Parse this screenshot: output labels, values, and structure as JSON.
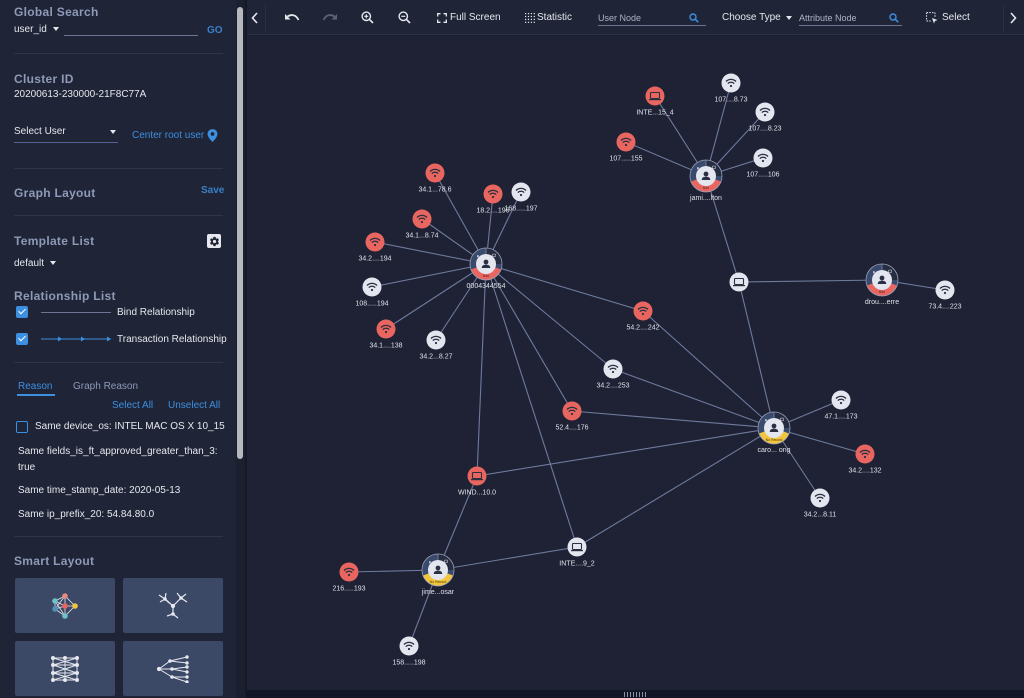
{
  "sidebar": {
    "global_search": {
      "title": "Global Search",
      "field_select": "user_id",
      "input_value": "",
      "go_label": "GO"
    },
    "cluster": {
      "title": "Cluster ID",
      "value": "20200613-230000-21F8C77A",
      "select_user_label": "Select User",
      "center_root_label": "Center root user"
    },
    "graph_layout": {
      "title": "Graph Layout",
      "save_label": "Save"
    },
    "template_list": {
      "title": "Template List",
      "selected": "default"
    },
    "relationship_list": {
      "title": "Relationship List",
      "items": [
        {
          "label": "Bind Relationship",
          "checked": true,
          "style": "solid"
        },
        {
          "label": "Transaction Relationship",
          "checked": true,
          "style": "arrows"
        }
      ]
    },
    "reason": {
      "tabs": [
        {
          "label": "Reason",
          "active": true
        },
        {
          "label": "Graph Reason",
          "active": false
        }
      ],
      "select_all_label": "Select All",
      "unselect_all_label": "Unselect All",
      "items": [
        {
          "text": "Same device_os: INTEL MAC OS X 10_15",
          "checkbox": true,
          "checked": false
        },
        {
          "text": "Same fields_is_ft_approved_greater_than_3:",
          "text2": "true",
          "checkbox": false
        },
        {
          "text": "Same time_stamp_date: 2020-05-13",
          "checkbox": false
        },
        {
          "text": "Same ip_prefix_20: 54.84.80.0",
          "checkbox": false
        }
      ]
    },
    "smart_layout": {
      "title": "Smart Layout",
      "buttons": [
        {
          "name": "force-layout",
          "icon": "force-graph-icon"
        },
        {
          "name": "radial-tree-layout",
          "icon": "radial-tree-icon"
        },
        {
          "name": "grid-layout",
          "icon": "grid-mesh-icon"
        },
        {
          "name": "dagre-layout",
          "icon": "hierarchy-tree-icon"
        }
      ]
    }
  },
  "toolbar": {
    "undo_icon": "undo-icon",
    "redo_icon": "redo-icon",
    "zoom_in_icon": "zoom-in-icon",
    "zoom_out_icon": "zoom-out-icon",
    "fullscreen_label": "Full Screen",
    "statistic_label": "Statistic",
    "user_node_placeholder": "User Node",
    "choose_type_label": "Choose Type",
    "attribute_node_placeholder": "Attribute Node",
    "select_label": "Select"
  },
  "colors": {
    "accent": "#3d8fe0",
    "bad": "#e8665f",
    "no_record": "#f2c53d",
    "neutral_node": "#e3e6ef",
    "edge": "#7d8bb0"
  },
  "graph": {
    "nodes": [
      {
        "id": "u1",
        "type": "user",
        "label": "0004344554",
        "status": "Bad"
      },
      {
        "id": "u2",
        "type": "user",
        "label": "jami....lton",
        "status": "Bad"
      },
      {
        "id": "u3",
        "type": "user",
        "label": "drou....erre",
        "status": "Bad"
      },
      {
        "id": "u4",
        "type": "user",
        "label": "caro... ong",
        "status": "No Record"
      },
      {
        "id": "u5",
        "type": "user",
        "label": "jime...osar",
        "status": "No Record"
      },
      {
        "id": "w1",
        "type": "wifi",
        "label": "34.1...78.6",
        "risk": "bad"
      },
      {
        "id": "w2",
        "type": "wifi",
        "label": "18.2....196",
        "risk": "bad"
      },
      {
        "id": "w3",
        "type": "wifi",
        "label": "168.....197",
        "risk": "normal"
      },
      {
        "id": "w4",
        "type": "wifi",
        "label": "34.1...8.74",
        "risk": "bad"
      },
      {
        "id": "w5",
        "type": "wifi",
        "label": "34.2....194",
        "risk": "bad"
      },
      {
        "id": "w6",
        "type": "wifi",
        "label": "108.....194",
        "risk": "normal"
      },
      {
        "id": "w7",
        "type": "wifi",
        "label": "34.1....138",
        "risk": "bad"
      },
      {
        "id": "w8",
        "type": "wifi",
        "label": "34.2...8.27",
        "risk": "normal"
      },
      {
        "id": "d1",
        "type": "device",
        "label": "INTE...15_4",
        "risk": "bad"
      },
      {
        "id": "w9",
        "type": "wifi",
        "label": "107....8.73",
        "risk": "normal"
      },
      {
        "id": "w10",
        "type": "wifi",
        "label": "107....8.23",
        "risk": "normal"
      },
      {
        "id": "w11",
        "type": "wifi",
        "label": "107.....155",
        "risk": "bad"
      },
      {
        "id": "w12",
        "type": "wifi",
        "label": "107.....106",
        "risk": "normal"
      },
      {
        "id": "d2",
        "type": "device",
        "label": "",
        "risk": "normal"
      },
      {
        "id": "w13",
        "type": "wifi",
        "label": "73.4....223",
        "risk": "normal"
      },
      {
        "id": "w14",
        "type": "wifi",
        "label": "54.2....242",
        "risk": "bad"
      },
      {
        "id": "w15",
        "type": "wifi",
        "label": "34.2....253",
        "risk": "normal"
      },
      {
        "id": "w16",
        "type": "wifi",
        "label": "52.4....176",
        "risk": "bad"
      },
      {
        "id": "w17",
        "type": "wifi",
        "label": "47.1....173",
        "risk": "normal"
      },
      {
        "id": "w18",
        "type": "wifi",
        "label": "34.2....132",
        "risk": "bad"
      },
      {
        "id": "w19",
        "type": "wifi",
        "label": "34.2...8.11",
        "risk": "normal"
      },
      {
        "id": "d3",
        "type": "device",
        "label": "WIND...10.0",
        "risk": "bad"
      },
      {
        "id": "d4",
        "type": "device",
        "label": "INTE....9_2",
        "risk": "normal"
      },
      {
        "id": "w20",
        "type": "wifi",
        "label": "216.....193",
        "risk": "bad"
      },
      {
        "id": "w21",
        "type": "wifi",
        "label": "158.....198",
        "risk": "normal"
      }
    ],
    "edges": [
      [
        "u1",
        "w1"
      ],
      [
        "u1",
        "w2"
      ],
      [
        "u1",
        "w3"
      ],
      [
        "u1",
        "w4"
      ],
      [
        "u1",
        "w5"
      ],
      [
        "u1",
        "w6"
      ],
      [
        "u1",
        "w7"
      ],
      [
        "u1",
        "w8"
      ],
      [
        "u1",
        "w14"
      ],
      [
        "u1",
        "w15"
      ],
      [
        "u1",
        "w16"
      ],
      [
        "u1",
        "d3"
      ],
      [
        "u1",
        "d4"
      ],
      [
        "u2",
        "d1"
      ],
      [
        "u2",
        "w9"
      ],
      [
        "u2",
        "w10"
      ],
      [
        "u2",
        "w11"
      ],
      [
        "u2",
        "w12"
      ],
      [
        "u2",
        "d2"
      ],
      [
        "d2",
        "u3"
      ],
      [
        "d2",
        "u4"
      ],
      [
        "u3",
        "w13"
      ],
      [
        "u4",
        "w14"
      ],
      [
        "u4",
        "w15"
      ],
      [
        "u4",
        "w16"
      ],
      [
        "u4",
        "d3"
      ],
      [
        "u4",
        "d4"
      ],
      [
        "u4",
        "w17"
      ],
      [
        "u4",
        "w18"
      ],
      [
        "u4",
        "w19"
      ],
      [
        "d3",
        "u5"
      ],
      [
        "u5",
        "w20"
      ],
      [
        "u5",
        "w21"
      ],
      [
        "u5",
        "d4"
      ]
    ]
  }
}
